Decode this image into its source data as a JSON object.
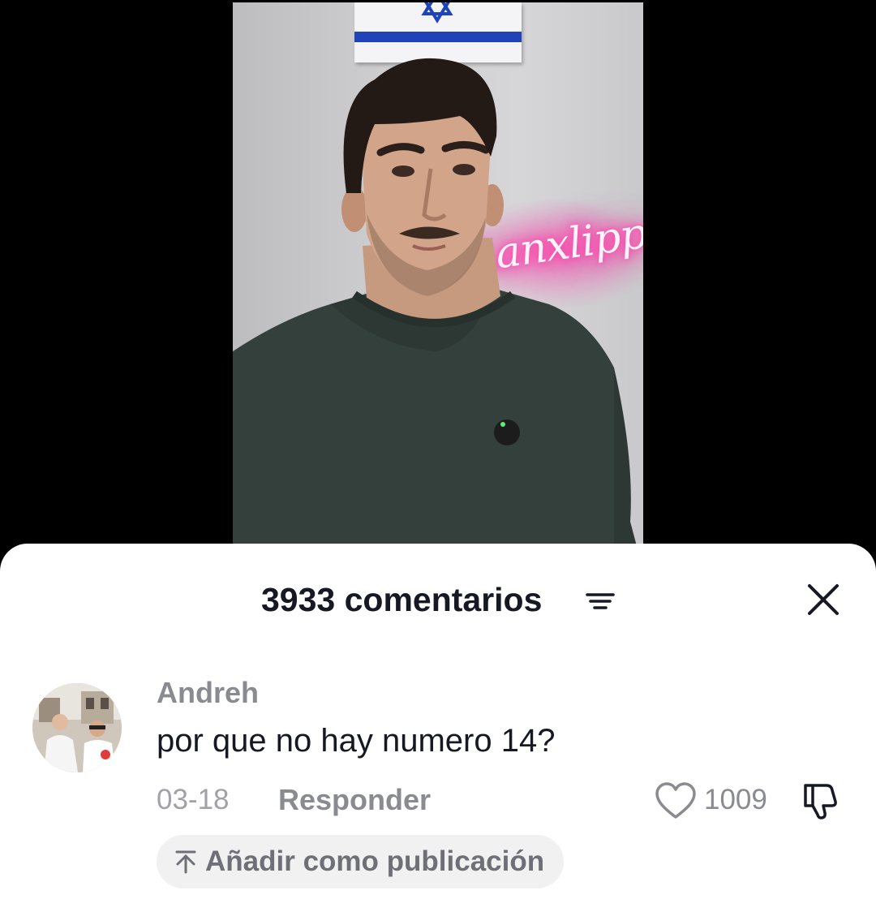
{
  "video": {
    "neon_sign_text": "Lanxlipp",
    "flag_icon": "israel-flag",
    "colors": {
      "neon": "#ff2d9e",
      "flag_blue": "#1f43b8"
    }
  },
  "comments_sheet": {
    "count_label": "3933 comentarios",
    "sort_icon": "sort-lines-icon",
    "close_icon": "close-x-icon"
  },
  "comments": [
    {
      "author": "Andreh",
      "text": "por que no hay numero 14?",
      "date": "03-18",
      "reply_label": "Responder",
      "like_count": "1009",
      "add_post_label": "Añadir como publicación"
    }
  ],
  "colors": {
    "primary_text": "#161823",
    "secondary_text": "#8a8b91",
    "chip_background": "#f1f1f2"
  }
}
